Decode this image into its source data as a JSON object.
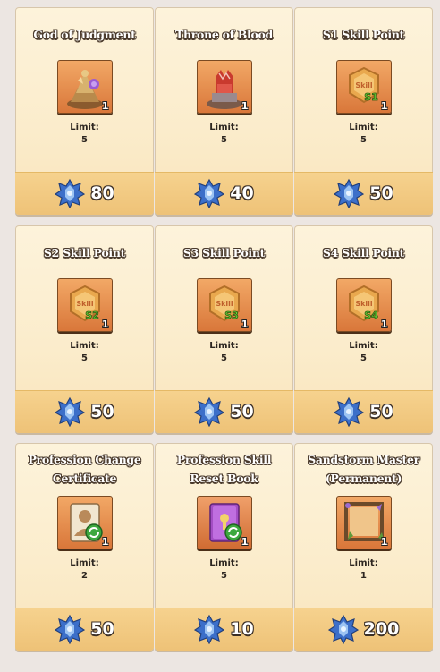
{
  "shop": {
    "limit_label": "Limit:",
    "items": [
      {
        "name": "God of Judgment",
        "icon": "god-of-judgment-statue-icon",
        "qty": "1",
        "limit": "5",
        "price": "80"
      },
      {
        "name": "Throne of Blood",
        "icon": "throne-of-blood-icon",
        "qty": "1",
        "limit": "5",
        "price": "40"
      },
      {
        "name": "S1 Skill Point",
        "icon": "skill-point-coin-icon",
        "badge": "S1",
        "qty": "1",
        "limit": "5",
        "price": "50"
      },
      {
        "name": "S2 Skill Point",
        "icon": "skill-point-coin-icon",
        "badge": "S2",
        "qty": "1",
        "limit": "5",
        "price": "50"
      },
      {
        "name": "S3 Skill Point",
        "icon": "skill-point-coin-icon",
        "badge": "S3",
        "qty": "1",
        "limit": "5",
        "price": "50"
      },
      {
        "name": "S4 Skill Point",
        "icon": "skill-point-coin-icon",
        "badge": "S4",
        "qty": "1",
        "limit": "5",
        "price": "50"
      },
      {
        "name": "Profession Change Certificate",
        "icon": "profession-change-certificate-icon",
        "qty": "1",
        "limit": "2",
        "price": "50"
      },
      {
        "name": "Profession Skill Reset Book",
        "icon": "skill-reset-book-icon",
        "qty": "1",
        "limit": "5",
        "price": "10"
      },
      {
        "name": "Sandstorm Master (Permanent)",
        "icon": "sandstorm-frame-icon",
        "qty": "1",
        "limit": "1",
        "price": "200"
      }
    ],
    "coin_text": "Skill",
    "currency_icon": "blue-crystal-gem-icon",
    "colors": {
      "card_bg": "#fbeccb",
      "price_bar": "#f2c97f",
      "icon_bg": "#e38c4b",
      "badge_green": "#5fc72c"
    }
  }
}
